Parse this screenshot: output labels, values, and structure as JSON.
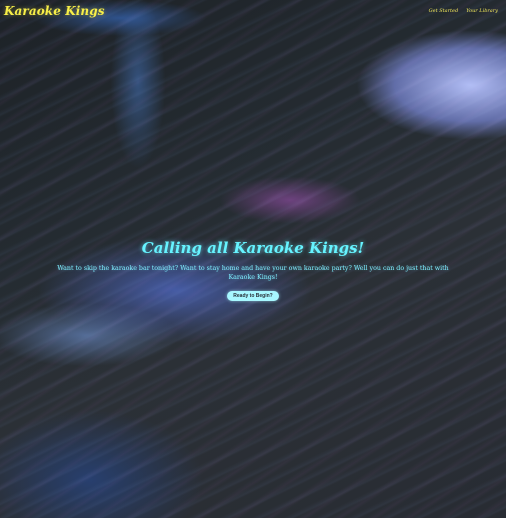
{
  "site": {
    "brand": "Karaoke Kings"
  },
  "nav": {
    "items": [
      {
        "label": "Get Started"
      },
      {
        "label": "Your Library"
      }
    ]
  },
  "hero": {
    "title": "Calling all Karaoke Kings!",
    "description": "Want to skip the karaoke bar tonight? Want to stay home and have your own karaoke party? Well you can do just that with Karaoke Kings!",
    "button_label": "Ready to Begin?"
  },
  "colors": {
    "brand": "#f8ef48",
    "nav": "#f3e95d",
    "hero_title": "#66f3ff",
    "hero_text": "#7eefff",
    "button_bg": "#a7f7ff",
    "button_text": "#28313a"
  }
}
